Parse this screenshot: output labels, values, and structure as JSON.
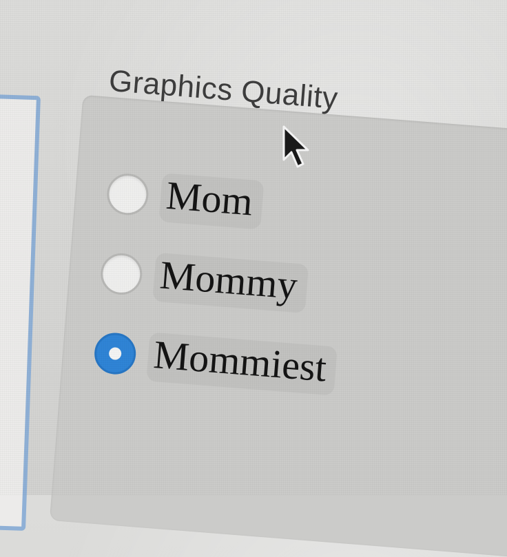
{
  "group": {
    "title": "Graphics Quality",
    "options": [
      {
        "label": "Mom",
        "selected": false
      },
      {
        "label": "Mommy",
        "selected": false
      },
      {
        "label": "Mommiest",
        "selected": true
      }
    ]
  },
  "colors": {
    "selected_radio": "#2f84d6",
    "panel_border": "#8fb0d6"
  },
  "icons": {
    "cursor": "arrow-cursor-icon"
  }
}
